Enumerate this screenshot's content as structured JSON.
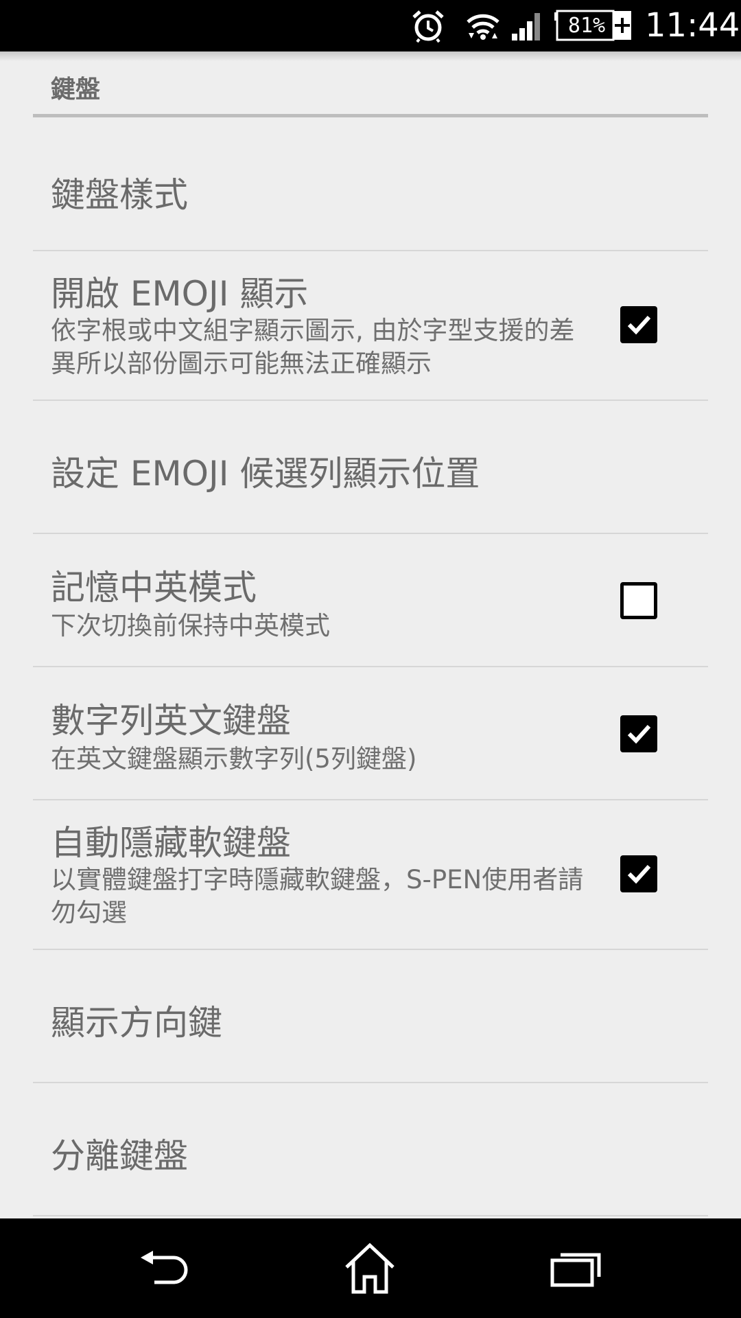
{
  "status_bar": {
    "battery": "81%",
    "time": "11:44",
    "icons": [
      "alarm-icon",
      "wifi-icon",
      "signal-icon",
      "battery-charging-icon"
    ]
  },
  "section": {
    "title": "鍵盤"
  },
  "preferences": [
    {
      "title": "鍵盤樣式",
      "summary": "",
      "checkbox": null
    },
    {
      "title": "開啟 EMOJI 顯示",
      "summary": "依字根或中文組字顯示圖示, 由於字型支援的差異所以部份圖示可能無法正確顯示",
      "checkbox": true
    },
    {
      "title": "設定 EMOJI 候選列顯示位置",
      "summary": "",
      "checkbox": null
    },
    {
      "title": "記憶中英模式",
      "summary": "下次切換前保持中英模式",
      "checkbox": false
    },
    {
      "title": "數字列英文鍵盤",
      "summary": "在英文鍵盤顯示數字列(5列鍵盤)",
      "checkbox": true
    },
    {
      "title": "自動隱藏軟鍵盤",
      "summary": "以實體鍵盤打字時隱藏軟鍵盤，S-PEN使用者請勿勾選",
      "checkbox": true
    },
    {
      "title": "顯示方向鍵",
      "summary": "",
      "checkbox": null
    },
    {
      "title": "分離鍵盤",
      "summary": "",
      "checkbox": null
    }
  ],
  "nav_bar": {
    "icons": [
      "back-icon",
      "home-icon",
      "recent-apps-icon"
    ]
  }
}
